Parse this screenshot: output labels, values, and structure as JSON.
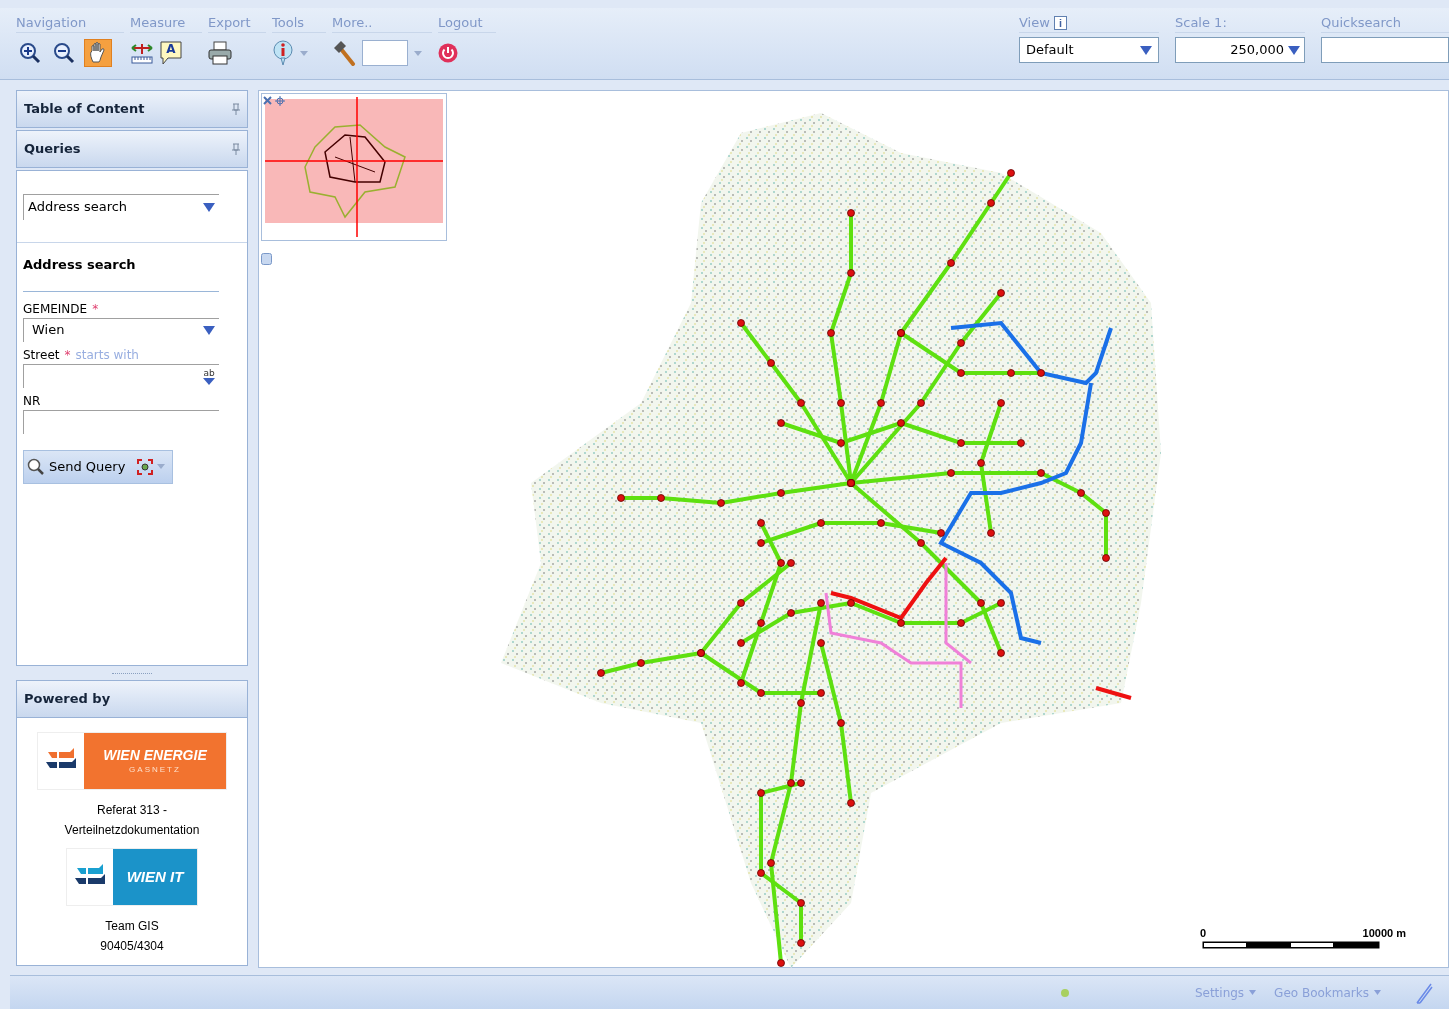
{
  "toolbar": {
    "groups": [
      {
        "kind": "navigation",
        "label": "Navigation",
        "tools": [
          {
            "selected": false
          },
          {
            "selected": false
          },
          {
            "selected": true
          }
        ]
      },
      {
        "kind": "measure",
        "label": "Measure",
        "annotation_glyph": "A"
      },
      {
        "kind": "export",
        "label": "Export"
      },
      {
        "kind": "tools",
        "label": "Tools"
      },
      {
        "kind": "more",
        "label": "More.."
      },
      {
        "kind": "logout",
        "label": "Logout"
      }
    ],
    "view": {
      "label": "View",
      "value": "Default"
    },
    "scale": {
      "label": "Scale 1:",
      "value": "250,000"
    },
    "quicksearch": {
      "label": "Quicksearch"
    }
  },
  "sidebar": {
    "panels": [
      {
        "title": "Table of Content"
      },
      {
        "title": "Queries"
      }
    ],
    "query_select": "Address search",
    "form": {
      "title": "Address search",
      "fields": [
        {
          "kind": "select",
          "label": "GEMEINDE",
          "required": true,
          "value": "Wien"
        },
        {
          "kind": "text",
          "label": "Street",
          "required": true,
          "hint": "starts with",
          "trigger_text": "ab"
        },
        {
          "kind": "plain",
          "label": "NR",
          "required": false
        }
      ],
      "required_marker": "*",
      "button": "Send Query"
    },
    "powered_by": {
      "title": "Powered by",
      "logos": [
        {
          "kind": "energie",
          "name": "WIEN ENERGIE",
          "sub": "GASNETZ",
          "caption": [
            "Referat 313 -",
            "Verteilnetzdokumentation"
          ]
        },
        {
          "kind": "it",
          "name": "WIEN IT",
          "caption": [
            "Team GIS",
            "90405/4304"
          ]
        }
      ]
    }
  },
  "map": {
    "scale_bar": {
      "start": "0",
      "end": "10000 m"
    }
  },
  "status_bar": {
    "menus": [
      "Settings",
      "Geo Bookmarks"
    ]
  }
}
